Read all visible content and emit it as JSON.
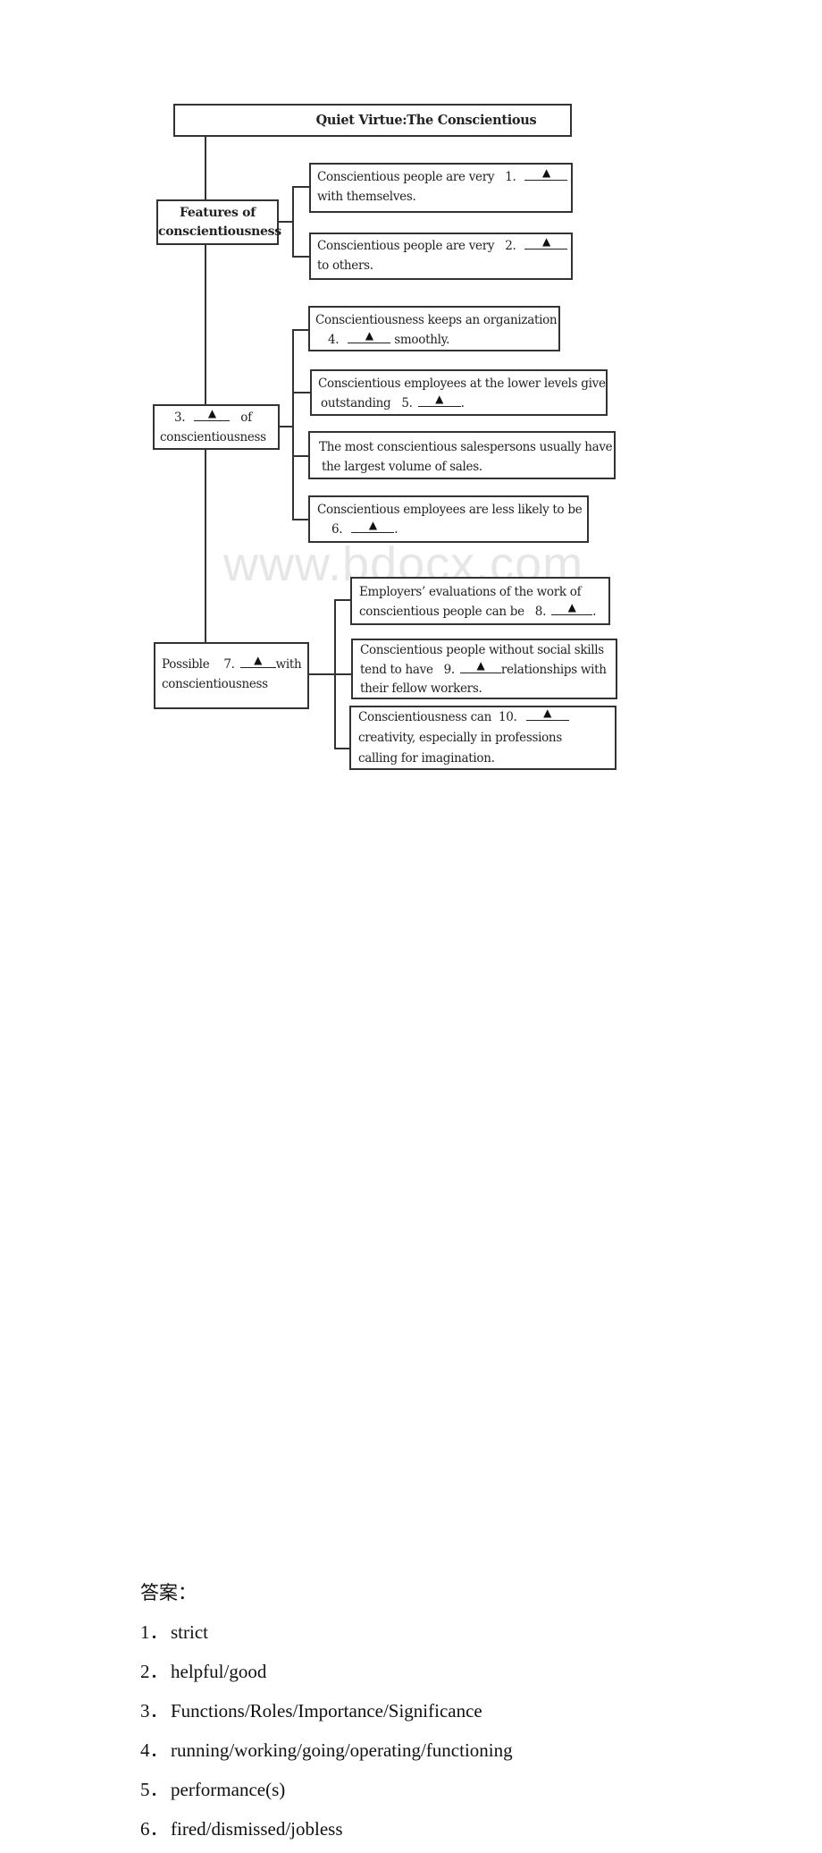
{
  "diagram": {
    "title": "Quiet Virtue:The Conscientious",
    "blank_marker": "▲",
    "sections": [
      {
        "label_lines": [
          "Features of",
          "conscientiousness"
        ],
        "items": [
          {
            "before": "Conscientious people are very",
            "num": "1.",
            "after_line2": "with themselves."
          },
          {
            "before": "Conscientious people are very",
            "num": "2.",
            "after_line2": "to others."
          }
        ]
      },
      {
        "label": {
          "num": "3.",
          "after": "of",
          "line2": "conscientiousness"
        },
        "items": [
          {
            "line1": "Conscientiousness keeps an organization",
            "num": "4.",
            "after": "smoothly."
          },
          {
            "line1": "Conscientious employees at the lower levels give",
            "before": "outstanding",
            "num": "5.",
            "after": "."
          },
          {
            "line1": "The most conscientious salespersons usually have",
            "line2": "the largest volume of sales."
          },
          {
            "line1": "Conscientious employees are less likely to be",
            "num": "6.",
            "after": "."
          }
        ]
      },
      {
        "label": {
          "before": "Possible",
          "num": "7.",
          "after": "with",
          "line2": "conscientiousness"
        },
        "items": [
          {
            "line1": "Employers’ evaluations of the work of",
            "before": "conscientious people can be",
            "num": "8.",
            "after": "."
          },
          {
            "line1": "Conscientious people without social skills",
            "before": "tend to have",
            "num": "9.",
            "after": "relationships with",
            "line3": "their fellow workers."
          },
          {
            "before": "Conscientiousness can",
            "num": "10.",
            "line2": "creativity, especially in professions",
            "line3": "calling for imagination."
          }
        ]
      }
    ]
  },
  "watermark": "www.bdocx.com",
  "answers": {
    "heading": "答案：",
    "items": [
      {
        "num": "1．",
        "text": "strict"
      },
      {
        "num": "2．",
        "text": "helpful/good"
      },
      {
        "num": "3．",
        "text": "Functions/Roles/Importance/Significance"
      },
      {
        "num": "4．",
        "text": "running/working/going/operating/functioning"
      },
      {
        "num": "5．",
        "text": "performance(s)"
      },
      {
        "num": "6．",
        "text": "fired/dismissed/jobless"
      }
    ]
  }
}
